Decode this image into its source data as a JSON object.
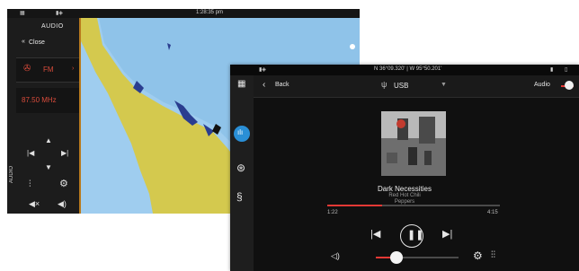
{
  "back_screen": {
    "time": "1:28:35 pm",
    "panel": {
      "title": "AUDIO",
      "close_label": "Close",
      "source": "FM",
      "frequency": "87.50 MHz",
      "side_label": "AUDIO"
    }
  },
  "front_screen": {
    "status": {
      "position": "N 36°09.320' | W 95°50.201'"
    },
    "header": {
      "back_label": "Back",
      "source_label": "USB",
      "right_label": "Audio"
    },
    "track": {
      "title": "Dark Necessities",
      "artist_line1": "Red Hot Chili",
      "artist_line2": "Peppers",
      "elapsed": "1:22",
      "duration": "4:15",
      "progress": 0.32
    },
    "volume": {
      "level": 0.25
    },
    "icons": {
      "menu": "grid-icon",
      "back": "chevron-left-icon",
      "usb": "usb-icon",
      "dropdown": "chevron-down-icon",
      "equalizer": "equalizer-icon",
      "wheel": "steering-wheel-icon",
      "boat": "seahorse-icon",
      "prev": "previous-track-icon",
      "pause": "pause-icon",
      "next": "next-track-icon",
      "speaker": "speaker-icon",
      "settings": "gear-icon",
      "mixer": "sliders-icon"
    },
    "colors": {
      "accent": "#e53935",
      "highlight": "#2a8fd6"
    }
  }
}
